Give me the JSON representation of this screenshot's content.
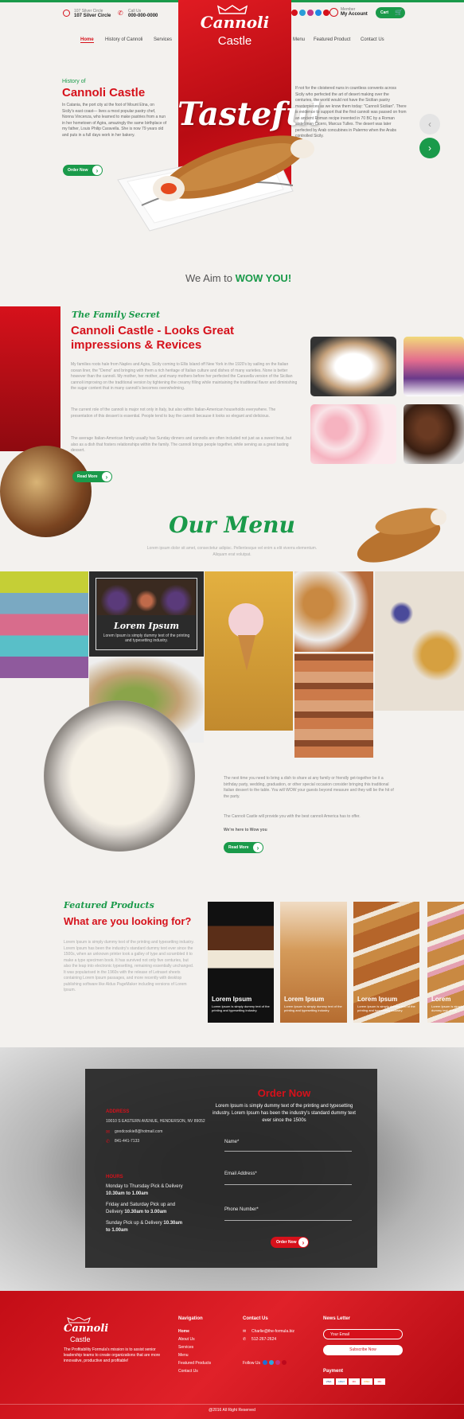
{
  "header": {
    "address_label": "107 Silver Circle",
    "address_value": "107 Silver Circle",
    "call_label": "Call Us",
    "call_value": "000-000-0000",
    "member_label": "Member",
    "member_value": "My Account",
    "cart_label": "Cart"
  },
  "logo": {
    "line1": "Cannoli",
    "line2": "Castle"
  },
  "nav": {
    "left": [
      "Home",
      "History of Cannoli",
      "Services"
    ],
    "right": [
      "Menu",
      "Featured Product",
      "Contact Us"
    ]
  },
  "hero": {
    "kicker": "History of",
    "title": "Cannoli Castle",
    "para": "In Catania, the port city at the foot of Mount Etna, on Sicily's east coast— lives a most popular pastry chef, Nonna Vincenza, who learned to make pastries from a nun in her hometown of Agira, amazingly the same birthplace of my father, Louis Philip Caravella. She is now 79 years old and puts in a full days work in her bakery.",
    "button": "Order Now",
    "word": "Tasteful",
    "right_para": "If not for the cloistered nuns in countless convents across Sicily who perfected the art of desert making over the centuries, the world would not have the Sicilian pastry masterpieces as we know them today: \"Cannoli Sicilian\". There is evidence to support that the first cannoli was passed on from an ancient Roman recipe invented in 70 BC by a Roman statesman Cicero, Marcus Tulles. The desert was later perfected by Arab concubines in Palermo when the Arabs controlled Sicily.",
    "aim_prefix": "We Aim to ",
    "aim_strong": "WOW YOU!"
  },
  "family": {
    "script": "The Family Secret",
    "title1": "Cannoli Castle - Looks Great",
    "title2": "impressions & Revices",
    "p1": "My families roots hale from Naples and Agira, Sicily coming to Ellis Island off New York in the 1920's by sailing on the Italian ocean liner, the \"Demo\" and bringing with them a rich heritage of Italian culture and dishes of many varieties. None is better however than the cannoli. My mother, her mother, and many mothers before her perfected the Caravella version of the Sicilian cannoli improving on the traditional version by tightening the creamy filling while maintaining the traditional flavor and diminishing the sugar content that in many cannoli's becomes overwhelming.",
    "p2": "The current role of the cannoli is major not only in Italy, but also within Italian-American households everywhere. The presentation of this dessert is essential. People tend to buy the cannoli because it looks so elegant and delicious.",
    "p3": "The average Italian-American family usually has Sunday dinners and cannolis are often included not just as a sweet treat, but also as a dish that fosters relationships within the family. The cannoli brings people together, while serving as a great tasting dessert.",
    "button": "Read More"
  },
  "menu": {
    "title": "Our Menu",
    "sub": "Lorem ipsum dolor sit amet, consectetur adipisc. Pellentesque vel enim a elit viverra elementum. Aliquam erat volutpat.",
    "tile_title": "Lorem Ipsum",
    "tile_text": "Lorem Ipsum is simply dummy text of the printing and typesetting industry."
  },
  "cake": {
    "p1": "The next time you need to bring a dish to share at any family or friendly get-together be it a birthday party, wedding, graduation, or other special occasion consider bringing this traditional Italian dessert to the table. You will WOW your guests beyond measure and they will be the hit of the party.",
    "p2": "The Cannoli Castle will provide you with the best cannoli America has to offer.",
    "p3": "We're here to Wow you",
    "button": "Read More"
  },
  "featured": {
    "script": "Featured Products",
    "title": "What are you looking for?",
    "para": "Lorem Ipsum is simply dummy text of the printing and typesetting industry. Lorem Ipsum has been the industry's standard dummy text ever since the 1500s, when an unknown printer took a galley of type and scrambled it to make a type specimen book. It has survived not only five centuries, but also the leap into electronic typesetting, remaining essentially unchanged. It was popularised in the 1960s with the release of Letraset sheets containing Lorem Ipsum passages, and more recently with desktop publishing software like Aldus PageMaker including versions of Lorem Ipsum.",
    "cards": [
      {
        "title": "Lorem Ipsum",
        "text": "Lorem Ipsum is simply dummy text of the printing and typesetting industry."
      },
      {
        "title": "Lorem Ipsum",
        "text": "Lorem Ipsum is simply dummy text of the printing and typesetting industry."
      },
      {
        "title": "Lorem Ipsum",
        "text": "Lorem Ipsum is simply dummy text of the printing and typesetting industry."
      },
      {
        "title": "Lorem",
        "text": "Lorem Ipsum is simply dummy text of the printing"
      }
    ]
  },
  "order": {
    "address_label": "Address",
    "address": "10010 S EASTERN AVENUE, HENDERSON, NV 89052",
    "email": "goodcookie8@hotmail.com",
    "phone": "841-441-7133",
    "hours_label": "Hours",
    "h1": "Monday to Thursday Pick & Delivery",
    "h1t": "10.30am to 1.00am",
    "h2": "Friday and Saturday Pick up and Delivery",
    "h2t": "10.30am to 3.00am",
    "h3": "Sunday Pick up & Delivery",
    "h3t": "10.30am to 1.00am",
    "title": "Order Now",
    "desc": "Lorem Ipsum is simply dummy text of the printing and typesetting industry. Lorem Ipsum has been the industry's standard dummy text ever since the 1500s",
    "name": "Name*",
    "email_field": "Email Address*",
    "phone_field": "Phone Number*",
    "button": "Order Now"
  },
  "footer": {
    "logo1": "Cannoli",
    "logo2": "Castle",
    "about": "The Profitability Formula's mission is to assist senior leadership teams to create organizations that are more innovative, productive and profitable!",
    "nav_title": "Navigation",
    "nav": [
      "Home",
      "About Us",
      "Services",
      "Menu",
      "Featured Products",
      "Contact Us"
    ],
    "contact_title": "Contact Us",
    "contact_email": "Charlie@the-formula.biz",
    "contact_phone": "512-267-2624",
    "follow": "Follow Us",
    "news_title": "News Letter",
    "news_placeholder": "Your Email",
    "news_button": "Subscribe Now",
    "payment": "Payment",
    "cards": [
      "VISA",
      "AMEX",
      "MC",
      "DISC",
      "MC"
    ],
    "copyright": "@2016 All Right Reserved"
  },
  "colors": {
    "red": "#d6111b",
    "green": "#1a9a4a",
    "dark": "#2c2c2c"
  }
}
